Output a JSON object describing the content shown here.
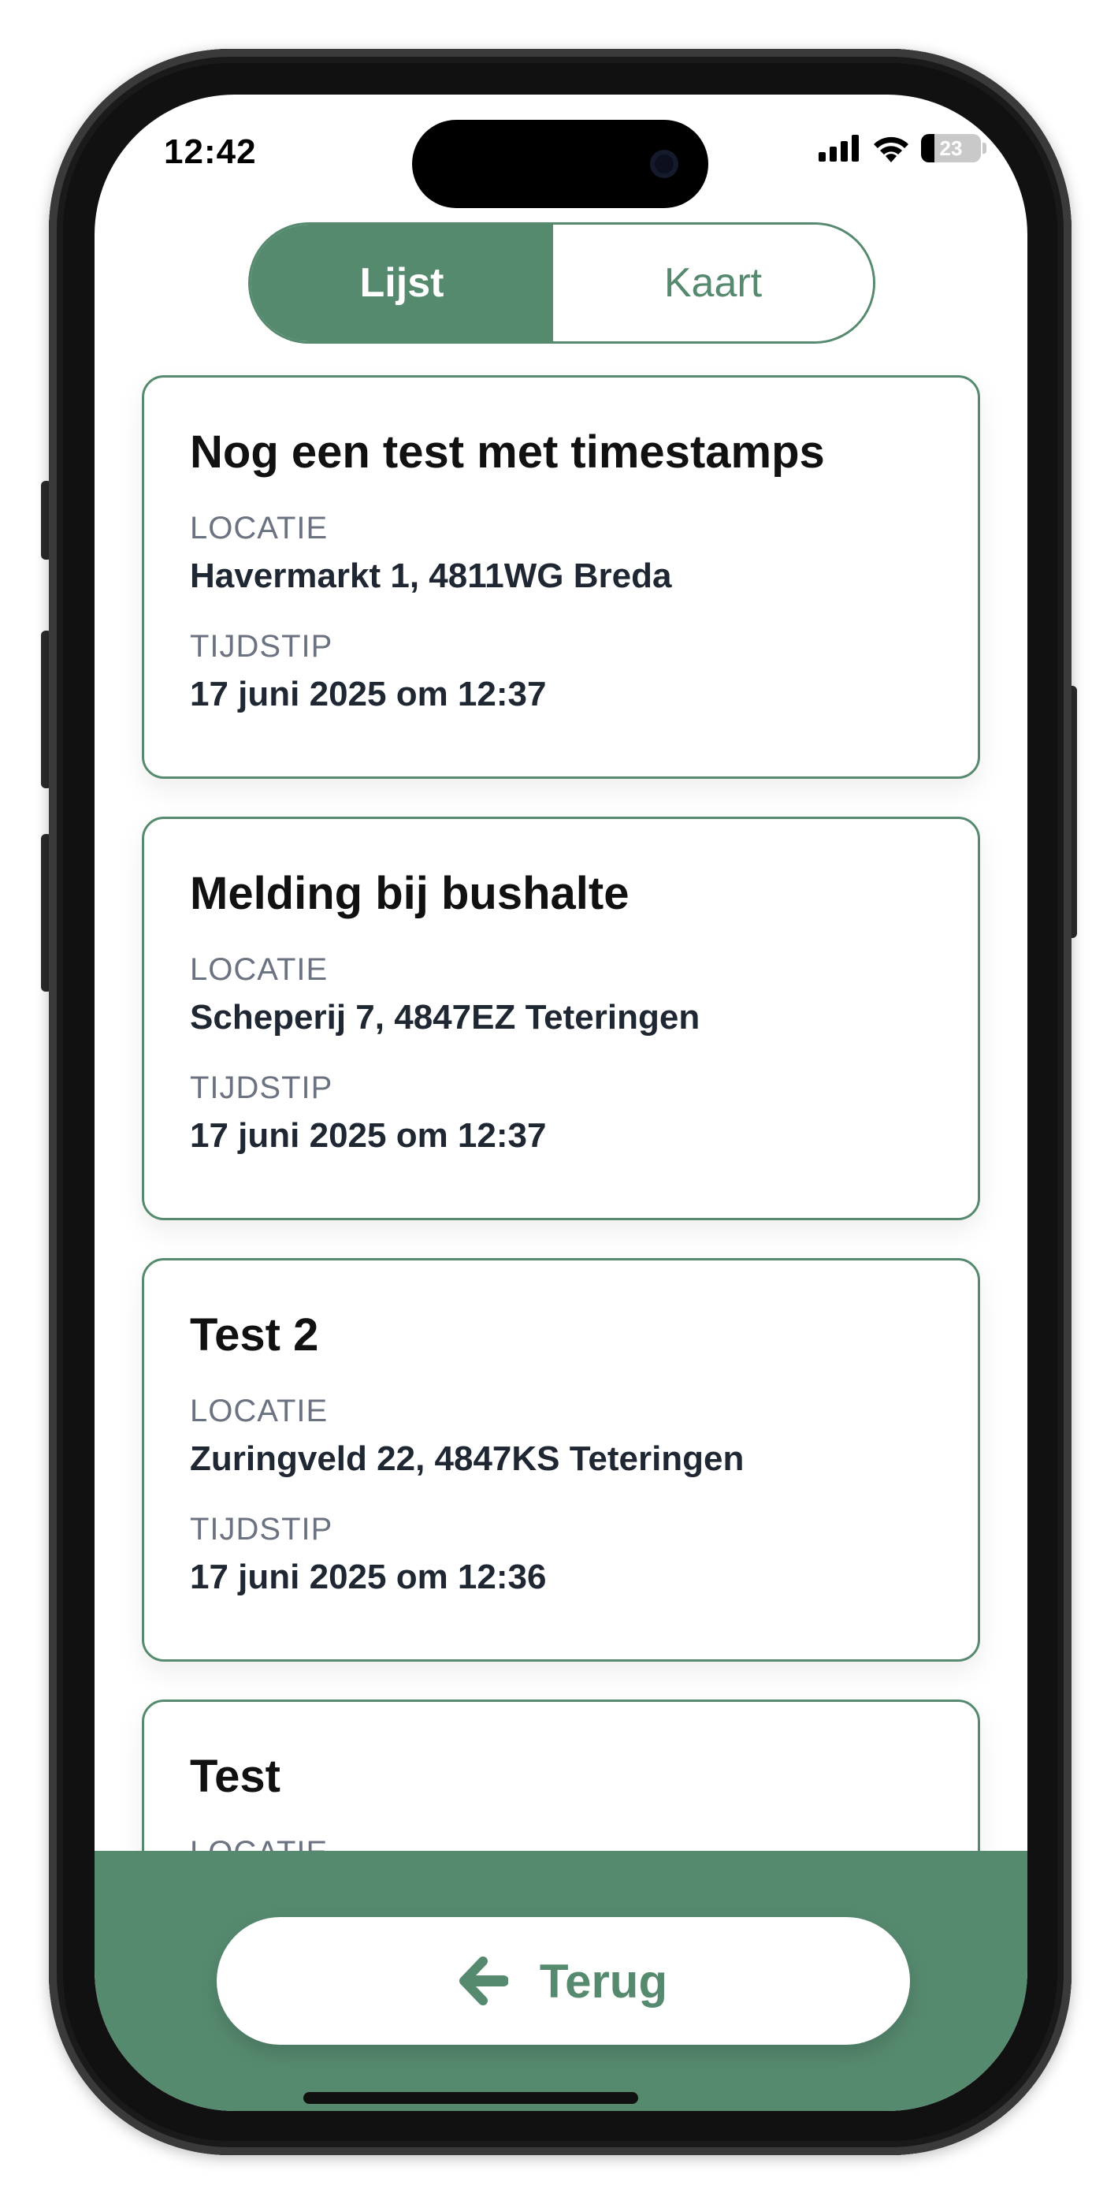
{
  "status_bar": {
    "time": "12:42",
    "battery": "23",
    "battery_level": 0.23
  },
  "view_toggle": {
    "list_label": "Lijst",
    "map_label": "Kaart",
    "active": "list"
  },
  "reports": [
    {
      "title": "Nog een test met timestamps",
      "location_label": "LOCATIE",
      "location": "Havermarkt 1, 4811WG Breda",
      "time_label": "TIJDSTIP",
      "time": "17 juni 2025 om 12:37"
    },
    {
      "title": "Melding bij bushalte",
      "location_label": "LOCATIE",
      "location": "Scheperij 7, 4847EZ Teteringen",
      "time_label": "TIJDSTIP",
      "time": "17 juni 2025 om 12:37"
    },
    {
      "title": "Test 2",
      "location_label": "LOCATIE",
      "location": "Zuringveld 22, 4847KS Teteringen",
      "time_label": "TIJDSTIP",
      "time": "17 juni 2025 om 12:36"
    },
    {
      "title": "Test",
      "location_label": "LOCATIE",
      "location": "",
      "time_label": "",
      "time": ""
    }
  ],
  "footer": {
    "back_label": "Terug",
    "back_icon": "arrow-left-icon"
  },
  "colors": {
    "accent": "#568a6f",
    "text": "#1f2733",
    "muted": "#6b7280"
  }
}
